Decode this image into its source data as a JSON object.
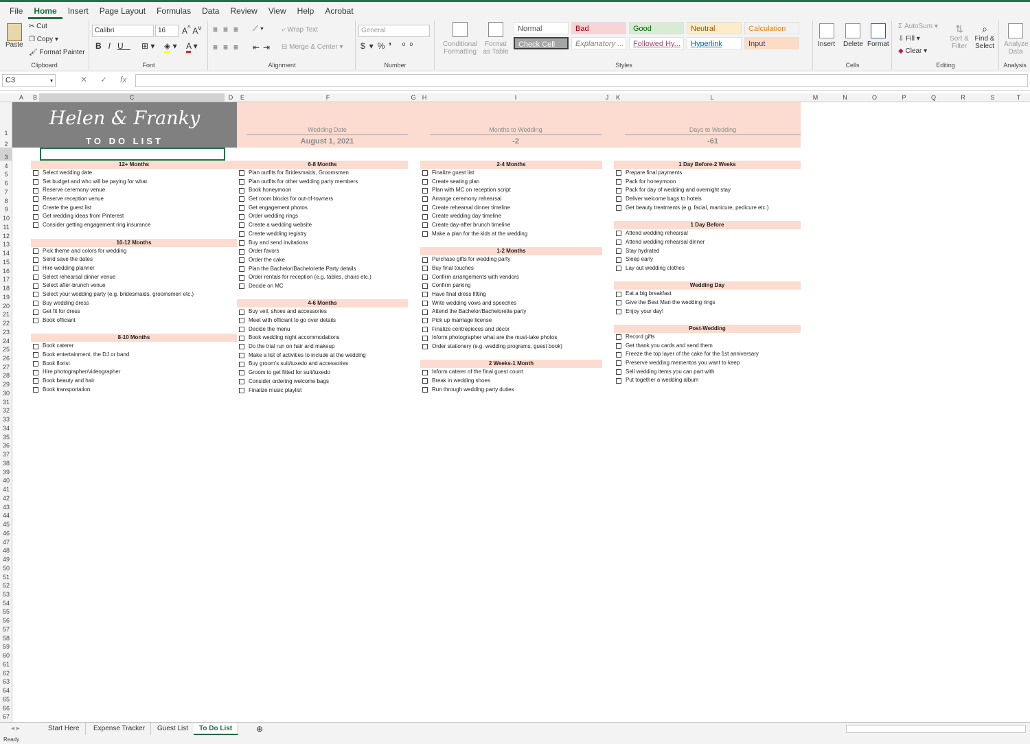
{
  "menu": [
    "File",
    "Home",
    "Insert",
    "Page Layout",
    "Formulas",
    "Data",
    "Review",
    "View",
    "Help",
    "Acrobat"
  ],
  "menu_active": "Home",
  "ribbon": {
    "clipboard": {
      "paste": "Paste",
      "cut": "Cut",
      "copy": "Copy",
      "format_painter": "Format Painter",
      "label": "Clipboard"
    },
    "font": {
      "name": "Calibri",
      "size": "16",
      "label": "Font"
    },
    "alignment": {
      "wrap": "Wrap Text",
      "merge": "Merge & Center",
      "label": "Alignment"
    },
    "number": {
      "format": "General",
      "label": "Number"
    },
    "styles": {
      "conditional": "Conditional Formatting",
      "format_table": "Format as Table",
      "cells": [
        {
          "name": "Normal",
          "bg": "#ffffff",
          "fg": "#555555"
        },
        {
          "name": "Bad",
          "bg": "#f7d3d6",
          "fg": "#9c0006"
        },
        {
          "name": "Good",
          "bg": "#d8ecd5",
          "fg": "#006100"
        },
        {
          "name": "Neutral",
          "bg": "#fcecc8",
          "fg": "#9c5700"
        },
        {
          "name": "Calculation",
          "bg": "#f2f2f2",
          "fg": "#fa7d00"
        },
        {
          "name": "Check Cell",
          "bg": "#a5a5a5",
          "fg": "#ffffff"
        },
        {
          "name": "Explanatory ...",
          "bg": "#ffffff",
          "fg": "#7f7f7f"
        },
        {
          "name": "Followed Hy...",
          "bg": "#ffffff",
          "fg": "#954f72"
        },
        {
          "name": "Hyperlink",
          "bg": "#ffffff",
          "fg": "#0563c1"
        },
        {
          "name": "Input",
          "bg": "#fcdcc4",
          "fg": "#3f3f76"
        }
      ],
      "label": "Styles"
    },
    "cells": {
      "insert": "Insert",
      "delete": "Delete",
      "format": "Format",
      "label": "Cells"
    },
    "editing": {
      "autosum": "AutoSum",
      "fill": "Fill",
      "clear": "Clear",
      "sort": "Sort & Filter",
      "find": "Find & Select",
      "label": "Editing"
    },
    "analysis": {
      "analyze": "Analyze Data",
      "label": "Analysis"
    }
  },
  "formula_bar": {
    "name_box": "C3",
    "fx": "fx",
    "value": ""
  },
  "columns": [
    "A",
    "B",
    "C",
    "D",
    "E",
    "F",
    "G",
    "H",
    "I",
    "J",
    "K",
    "L",
    "M",
    "N",
    "O",
    "P",
    "Q",
    "R",
    "S",
    "T"
  ],
  "rows_count": 67,
  "sheet": {
    "title_script": "Helen & Franky",
    "title_sub": "TO DO LIST",
    "wedding_date_label": "Wedding Date",
    "wedding_date": "August 1, 2021",
    "months_label": "Months to Wedding",
    "months_value": "-2",
    "days_label": "Days to Wedding",
    "days_value": "-61",
    "columns": [
      [
        {
          "title": "12+ Months",
          "items": [
            "Select wedding date",
            "Set budget and who will be paying for what",
            "Reserve ceremony venue",
            "Reserve reception venue",
            "Create the guest list",
            "Get wedding ideas from Pinterest",
            "Consider getting engagement ring insurance"
          ]
        },
        {
          "title": "10-12 Months",
          "items": [
            "Pick theme and colors for wedding",
            "Send save the dates",
            "Hire wedding planner",
            "Select rehearsal dinner venue",
            "Select after-brunch venue",
            "Select your wedding party (e.g. bridesmaids, groomsmen etc.)",
            "Buy wedding dress",
            "Get fit for dress",
            "Book officiant"
          ]
        },
        {
          "title": "8-10 Months",
          "items": [
            "Book caterer",
            "Book entertainment, the DJ or band",
            "Book florist",
            "Hire photographer/videographer",
            "Book beauty and hair",
            "Book transportation"
          ]
        }
      ],
      [
        {
          "title": "6-8 Months",
          "items": [
            "Plan outfits for Bridesmaids, Groomsmen",
            "Plan outfits for other wedding party members",
            "Book honeymoon",
            "Get room blocks for out-of-towners",
            "Get engagement photos",
            "Order wedding rings",
            "Create a wedding website",
            "Create wedding registry",
            "Buy and send invitations",
            "Order favors",
            "Order the cake",
            "Plan the Bachelor/Bachelorette Party details",
            "Order rentals for reception (e.g. tables, chairs etc.)",
            "Decide on MC"
          ]
        },
        {
          "title": "4-6 Months",
          "items": [
            "Buy veil, shoes and accessories",
            "Meet with officiant to go over details",
            "Decide the menu",
            "Book wedding night accommodations",
            "Do the trial run on hair and makeup",
            "Make a list of activities to include at the wedding",
            "Buy groom's suit/tuxedo and accessories",
            "Groom to get fitted for suit/tuxedo",
            "Consider ordering welcome bags",
            "Finalize music playlist"
          ]
        }
      ],
      [
        {
          "title": "2-4 Months",
          "items": [
            "Finalize guest list",
            "Create seating plan",
            "Plan with MC on reception script",
            "Arrange ceremony rehearsal",
            "Create rehearsal dinner timeline",
            "Create wedding day timeline",
            "Create day-after brunch timeline",
            "Make a plan for the kids at the wedding"
          ]
        },
        {
          "title": "1-2 Months",
          "items": [
            "Purchase gifts for wedding party",
            "Buy final touches",
            "Confirm arrangements with vendors",
            "Confirm parking",
            "Have final dress fitting",
            "Write wedding vows and speeches",
            "Attend the Bachelor/Bachelorette party",
            "Pick up marriage license",
            "Finalize centrepieces and décor",
            "Inform photographer what are the must-take photos",
            "Order stationery (e.g. wedding programs, guest book)"
          ]
        },
        {
          "title": "2 Weeks-1 Month",
          "items": [
            "Inform caterer of the final guest count",
            "Break in wedding shoes",
            "Run through wedding party duties"
          ]
        }
      ],
      [
        {
          "title": "1 Day Before-2 Weeks",
          "items": [
            "Prepare final payments",
            "Pack for honeymoon",
            "Pack for day of wedding and overnight stay",
            "Deliver welcome bags to hotels",
            "Get beauty treatments (e.g. facial, manicure, pedicure etc.)"
          ]
        },
        {
          "title": "1 Day Before",
          "items": [
            "Attend wedding rehearsal",
            "Attend wedding rehearsal dinner",
            "Stay hydrated",
            "Sleep early",
            "Lay out wedding clothes"
          ]
        },
        {
          "title": "Wedding Day",
          "items": [
            "Eat a big breakfast",
            "Give the Best Man the wedding rings",
            "Enjoy your day!"
          ]
        },
        {
          "title": "Post-Wedding",
          "items": [
            "Record gifts",
            "Get thank you cards and send them",
            "Freeze the top layer of the cake for the 1st anniversary",
            "Preserve wedding mementos you want to keep",
            "Sell wedding items you can part with",
            "Put together a wedding album"
          ]
        }
      ]
    ]
  },
  "sheet_tabs": [
    "Start Here",
    "Expense Tracker",
    "Guest List",
    "To Do List"
  ],
  "active_tab": "To Do List",
  "status": "Ready",
  "colors": {
    "accent": "#217346",
    "pink": "#fcdcd0",
    "gray": "#808080"
  }
}
